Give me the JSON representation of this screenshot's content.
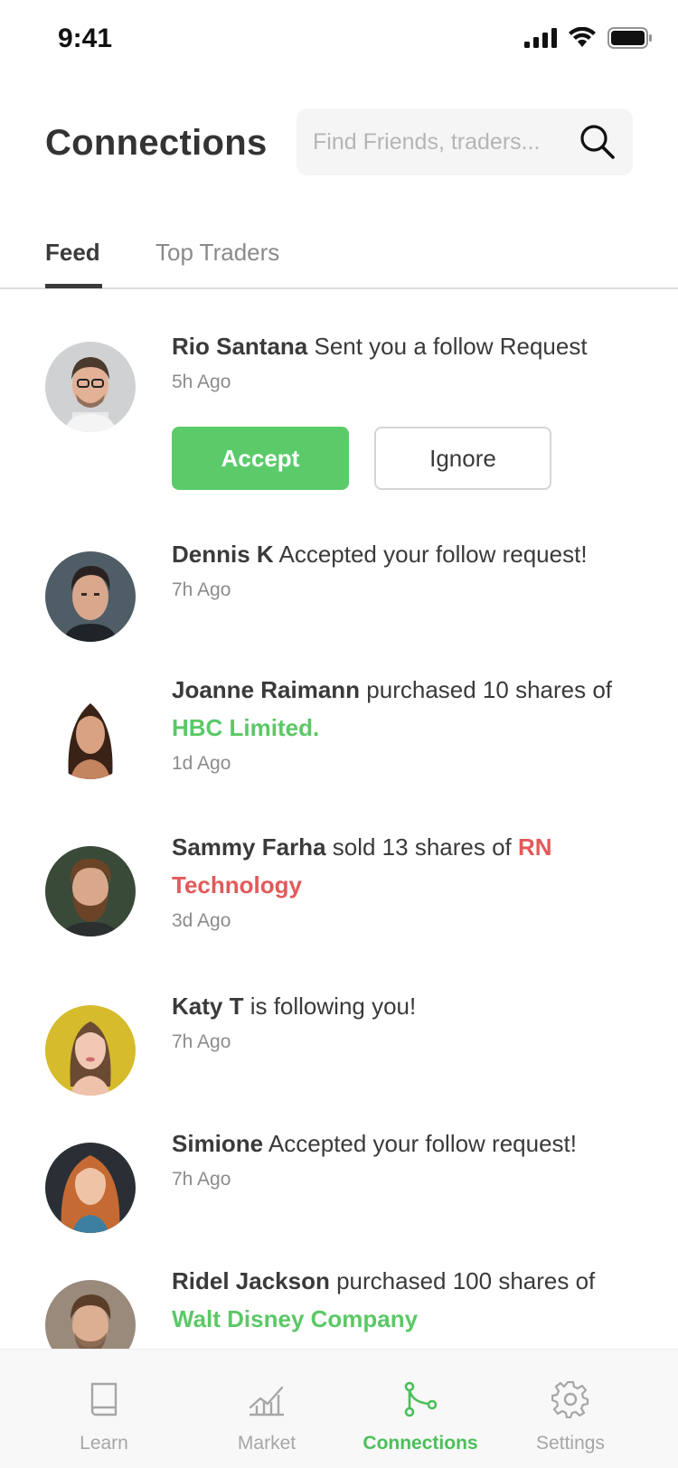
{
  "status_bar": {
    "time": "9:41"
  },
  "header": {
    "title": "Connections",
    "search_placeholder": "Find Friends, traders..."
  },
  "tabs": [
    {
      "label": "Feed",
      "active": true
    },
    {
      "label": "Top Traders",
      "active": false
    }
  ],
  "feed": [
    {
      "name": "Rio Santana",
      "action": " Sent you a follow Request",
      "time": "5h Ago",
      "accept_label": "Accept",
      "ignore_label": "Ignore"
    },
    {
      "name": "Dennis K",
      "action": " Accepted your follow request!",
      "time": "7h Ago"
    },
    {
      "name": "Joanne Raimann",
      "action": " purchased 10 shares of ",
      "link": "HBC Limited.",
      "time": "1d Ago"
    },
    {
      "name": "Sammy Farha",
      "action": " sold 13 shares of ",
      "link": "RN Technology",
      "time": "3d Ago"
    },
    {
      "name": "Katy T",
      "action": " is following you!",
      "time": "7h Ago"
    },
    {
      "name": "Simione",
      "action": " Accepted your follow request!",
      "time": "7h Ago"
    },
    {
      "name": "Ridel Jackson",
      "action": " purchased 100 shares of ",
      "link": "Walt Disney Company"
    }
  ],
  "bottom_nav": [
    {
      "label": "Learn",
      "icon": "book-icon",
      "active": false
    },
    {
      "label": "Market",
      "icon": "market-chart-icon",
      "active": false
    },
    {
      "label": "Connections",
      "icon": "connections-icon",
      "active": true
    },
    {
      "label": "Settings",
      "icon": "gear-icon",
      "active": false
    }
  ],
  "colors": {
    "accent_green": "#5bcb6a",
    "sell_red": "#e25a5a",
    "text_dark": "#3a3a3a",
    "text_muted": "#8c8c8c"
  }
}
